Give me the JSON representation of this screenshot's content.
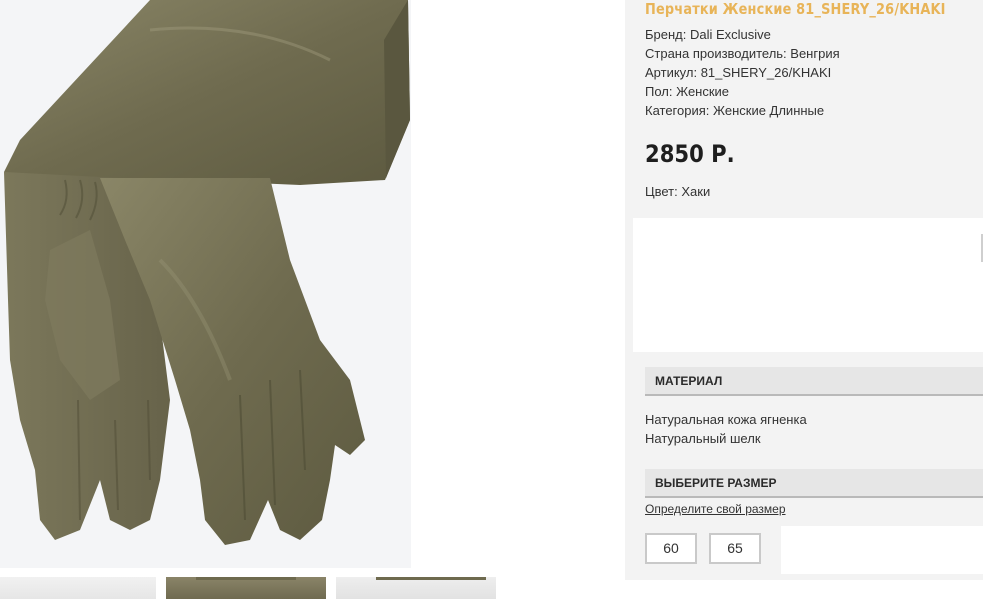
{
  "product": {
    "title": "Перчатки Женские 81_SHERY_26/KHAKI",
    "attributes": [
      "Бренд: Dali Exclusive",
      "Страна производитель: Венгрия",
      "Артикул: 81_SHERY_26/KHAKI",
      "Пол: Женские",
      "Категория: Женские Длинные"
    ],
    "price": "2850 Р.",
    "color_line": "Цвет: Хаки"
  },
  "material": {
    "header": "МАТЕРИАЛ",
    "items": [
      "Натуральная кожа ягненка",
      "Натуральный шелк"
    ]
  },
  "size": {
    "header": "ВЫБЕРИТЕ РАЗМЕР",
    "guide_link": "Определите свой размер",
    "options": [
      "60",
      "65"
    ]
  },
  "colors": {
    "title_accent": "#e8b458",
    "leather_khaki": "#6f6a4f",
    "panel_bg": "#f3f3f3"
  },
  "gallery": {
    "main_image": "long-khaki-leather-gloves-photo",
    "thumbnail_count": 3
  }
}
